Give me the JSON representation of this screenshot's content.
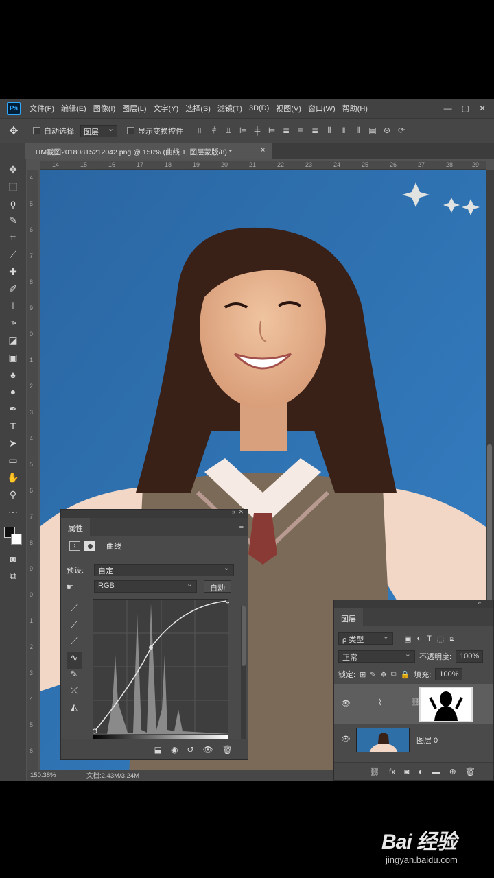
{
  "menubar": {
    "logo": "Ps",
    "items": [
      "文件(F)",
      "编辑(E)",
      "图像(I)",
      "图层(L)",
      "文字(Y)",
      "选择(S)",
      "滤镜(T)",
      "3D(D)",
      "视图(V)",
      "窗口(W)",
      "帮助(H)"
    ],
    "window_controls": [
      "—",
      "▢",
      "✕"
    ]
  },
  "options": {
    "auto_select_label": "自动选择:",
    "auto_select_target": "图层",
    "show_transform_label": "显示变换控件"
  },
  "document": {
    "tab_title": "TIM截图20180815212042.png @ 150% (曲线 1, 图层蒙版/8) *",
    "close": "×"
  },
  "rulers": {
    "horizontal": [
      "14",
      "15",
      "16",
      "17",
      "18",
      "19",
      "20",
      "21",
      "22",
      "23",
      "24",
      "25",
      "26",
      "27",
      "28",
      "29"
    ],
    "vertical": [
      "4",
      "5",
      "6",
      "7",
      "8",
      "9",
      "0",
      "1",
      "2",
      "3",
      "4",
      "5",
      "6",
      "7",
      "8",
      "9",
      "0",
      "1",
      "2",
      "3",
      "4",
      "5",
      "6",
      "7"
    ]
  },
  "status": {
    "zoom": "150.38%",
    "doc_size": "文档:2.43M/3.24M"
  },
  "properties": {
    "tab_label": "属性",
    "adjustment_title": "曲线",
    "preset_label": "预设:",
    "preset_value": "自定",
    "channel_value": "RGB",
    "auto_label": "自动"
  },
  "layers": {
    "tab_label": "图层",
    "filter_value": "ρ 类型",
    "blend_mode": "正常",
    "opacity_label": "不透明度:",
    "opacity_value": "100%",
    "lock_label": "锁定:",
    "fill_label": "填充:",
    "fill_value": "100%",
    "items": [
      {
        "name": ""
      },
      {
        "name": "图层 0"
      }
    ]
  },
  "watermark": {
    "main": "Bai 经验",
    "sub": "jingyan.baidu.com"
  }
}
